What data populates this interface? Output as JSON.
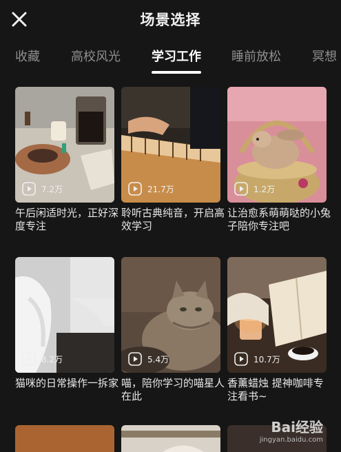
{
  "header": {
    "title": "场景选择",
    "close_icon": "close-icon"
  },
  "tabs": [
    {
      "label": "收藏",
      "active": false
    },
    {
      "label": "高校风光",
      "active": false
    },
    {
      "label": "学习工作",
      "active": true
    },
    {
      "label": "睡前放松",
      "active": false
    },
    {
      "label": "冥想",
      "active": false
    }
  ],
  "cards": [
    {
      "views": "7.2万",
      "caption": "午后闲适时光，正好深度专注",
      "scene": "coffee-desk"
    },
    {
      "views": "21.7万",
      "caption": "聆听古典纯音，开启高效学习",
      "scene": "piano-hands"
    },
    {
      "views": "1.2万",
      "caption": "让治愈系萌萌哒的小兔子陪你专注吧",
      "scene": "bunny-basket"
    },
    {
      "views": "8.2万",
      "caption": "猫咪的日常操作一拆家",
      "scene": "white-cat"
    },
    {
      "views": "5.4万",
      "caption": "喵，陪你学习的喵星人在此",
      "scene": "tabby-cat"
    },
    {
      "views": "10.7万",
      "caption": "香薰蜡烛 提神咖啡专注看书~",
      "scene": "candle-book"
    }
  ],
  "watermark": {
    "logo": "Bai经验",
    "url": "jingyan.baidu.com"
  },
  "colors": {
    "background": "#161616",
    "active_tab": "#ffffff",
    "inactive_tab": "#8f8f8f"
  }
}
